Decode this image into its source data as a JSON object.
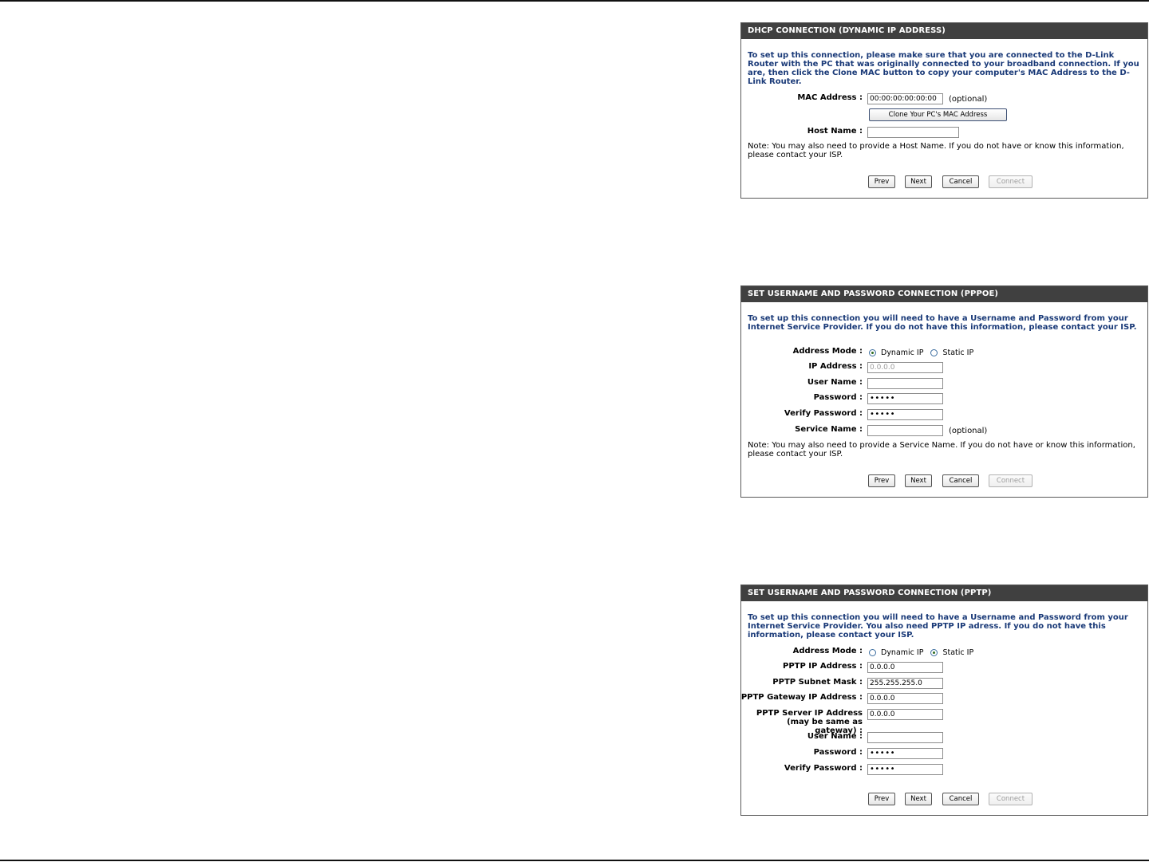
{
  "panels": {
    "dhcp": {
      "title": "DHCP CONNECTION (DYNAMIC IP ADDRESS)",
      "intro": "To set up this connection, please make sure that you are connected to the D-Link Router with the PC that was originally connected to your broadband connection. If you are, then click the Clone MAC button to copy your computer's MAC Address to the D-Link Router.",
      "mac_label": "MAC Address :",
      "mac_value": "00:00:00:00:00:00",
      "optional": "(optional)",
      "clone_button": "Clone Your PC's MAC Address",
      "host_label": "Host Name :",
      "host_value": "",
      "note": "Note: You may also need to provide a Host Name. If you do not have or know this information, please contact your ISP.",
      "buttons": {
        "prev": "Prev",
        "next": "Next",
        "cancel": "Cancel",
        "connect": "Connect"
      }
    },
    "pppoe": {
      "title": "SET USERNAME AND PASSWORD CONNECTION (PPPOE)",
      "intro": "To set up this connection you will need to have a Username and Password from your Internet Service Provider. If you do not have this information, please contact your ISP.",
      "address_mode_label": "Address Mode :",
      "dynamic_ip": "Dynamic IP",
      "static_ip": "Static IP",
      "selected_mode": "Dynamic IP",
      "ip_label": "IP Address :",
      "ip_value": "0.0.0.0",
      "user_label": "User Name :",
      "user_value": "",
      "password_label": "Password :",
      "password_value": "•••••",
      "verify_label": "Verify Password :",
      "verify_value": "•••••",
      "service_label": "Service Name :",
      "service_value": "",
      "optional": "(optional)",
      "note": "Note: You may also need to provide a Service Name. If you do not have or know this information, please contact your ISP.",
      "buttons": {
        "prev": "Prev",
        "next": "Next",
        "cancel": "Cancel",
        "connect": "Connect"
      }
    },
    "pptp": {
      "title": "SET USERNAME AND PASSWORD CONNECTION (PPTP)",
      "intro": "To set up this connection you will need to have a Username and Password from your Internet Service Provider. You also need PPTP IP adress. If you do not have this information, please contact your ISP.",
      "address_mode_label": "Address Mode :",
      "dynamic_ip": "Dynamic IP",
      "static_ip": "Static IP",
      "selected_mode": "Static IP",
      "pptp_ip_label": "PPTP IP Address :",
      "pptp_ip_value": "0.0.0.0",
      "subnet_label": "PPTP Subnet Mask :",
      "subnet_value": "255.255.255.0",
      "gateway_label": "PPTP Gateway IP Address :",
      "gateway_value": "0.0.0.0",
      "server_label": "PPTP Server IP Address (may be same as gateway) :",
      "server_value": "0.0.0.0",
      "user_label": "User Name :",
      "user_value": "",
      "password_label": "Password :",
      "password_value": "•••••",
      "verify_label": "Verify Password :",
      "verify_value": "•••••",
      "buttons": {
        "prev": "Prev",
        "next": "Next",
        "cancel": "Cancel",
        "connect": "Connect"
      }
    }
  },
  "colors": {
    "header_bg": "#404040",
    "intro_text": "#1a3a78",
    "radio_checked": "#2f6b1f"
  }
}
